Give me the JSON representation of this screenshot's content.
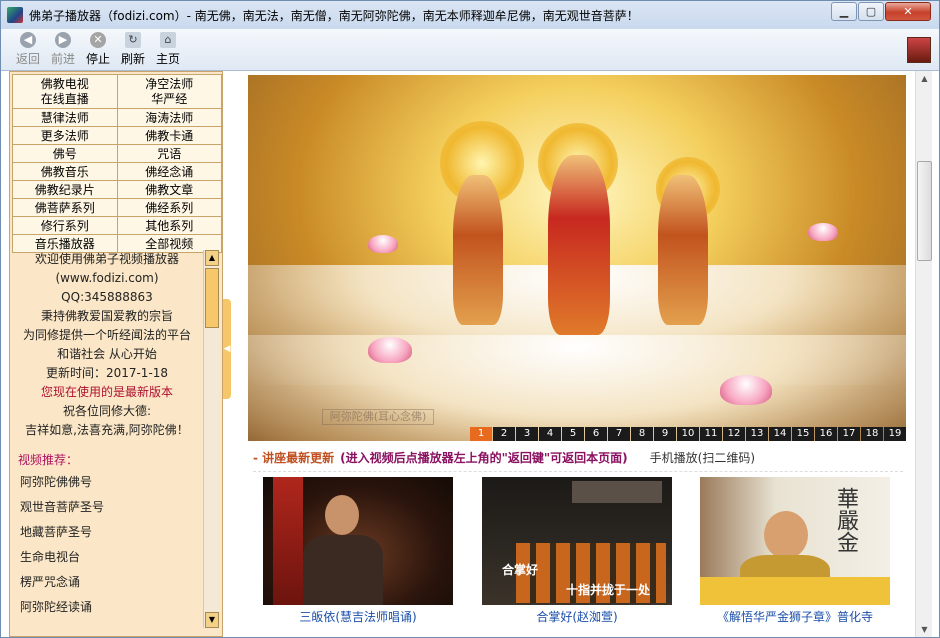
{
  "window": {
    "title": "佛弟子播放器（fodizi.com）- 南无佛，南无法，南无僧，南无阿弥陀佛，南无本师释迦牟尼佛，南无观世音菩萨！",
    "minimize": "▁",
    "maximize": "▢",
    "close": "✕"
  },
  "toolbar": {
    "back": "返回",
    "forward": "前进",
    "stop": "停止",
    "refresh": "刷新",
    "home": "主页"
  },
  "menu": [
    [
      "佛教电视\n在线直播",
      "净空法师\n华严经"
    ],
    [
      "慧律法师",
      "海涛法师"
    ],
    [
      "更多法师",
      "佛教卡通"
    ],
    [
      "佛号",
      "咒语"
    ],
    [
      "佛教音乐",
      "佛经念诵"
    ],
    [
      "佛教纪录片",
      "佛教文章"
    ],
    [
      "佛菩萨系列",
      "佛经系列"
    ],
    [
      "修行系列",
      "其他系列"
    ],
    [
      "音乐播放器",
      "全部视频"
    ]
  ],
  "welcome": {
    "l1": "欢迎使用佛弟子视频播放器",
    "l2": "(www.fodizi.com)",
    "l3": "QQ:345888863",
    "l4": "秉持佛教爱国爱教的宗旨",
    "l5": "为同修提供一个听经闻法的平台",
    "l6": "和谐社会 从心开始",
    "l7": "更新时间：2017-1-18",
    "l8": "您现在使用的是最新版本",
    "l9": "祝各位同修大德:",
    "l10": "吉祥如意,法喜充满,阿弥陀佛！",
    "rec_title": "视频推荐：",
    "links": [
      "阿弥陀佛佛号",
      "观世音菩萨圣号",
      "地藏菩萨圣号",
      "生命电视台",
      "楞严咒念诵",
      "阿弥陀经读诵"
    ]
  },
  "banner": {
    "watermark": "阿弥陀佛(耳心念佛)",
    "pages": [
      "1",
      "2",
      "3",
      "4",
      "5",
      "6",
      "7",
      "8",
      "9",
      "10",
      "11",
      "12",
      "13",
      "14",
      "15",
      "16",
      "17",
      "18",
      "19"
    ],
    "active_page": 1
  },
  "news": {
    "label": "- 讲座最新更新",
    "hint": "(进入视频后点播放器左上角的\"返回键\"可返回本页面)",
    "mobile": "手机播放(扫二维码)"
  },
  "videos": [
    {
      "caption": "三皈依(慧吉法师唱诵)"
    },
    {
      "caption": "合掌好(赵洳萱)",
      "overlay1": "合掌好",
      "overlay2": "十指并拢于一处"
    },
    {
      "caption": "《解悟华严金狮子章》普化寺",
      "overlay1": "華嚴金"
    }
  ]
}
